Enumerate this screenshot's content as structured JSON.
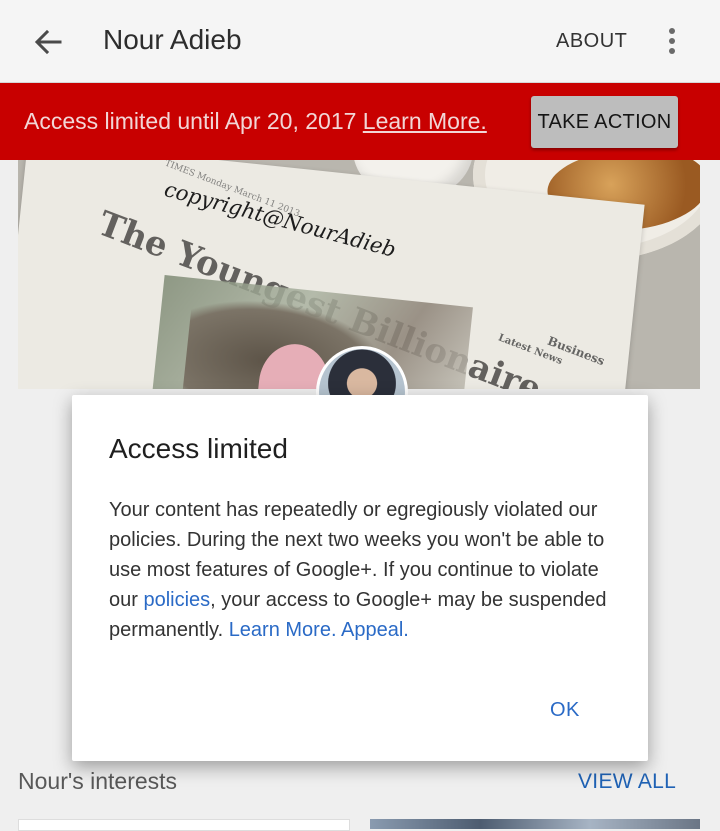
{
  "appbar": {
    "title": "Nour Adieb",
    "about_label": "ABOUT",
    "back_icon": "arrow-left-icon",
    "more_icon": "more-vert-icon"
  },
  "banner": {
    "text": "Access limited until Apr 20, 2017",
    "link": "Learn More.",
    "action_label": "TAKE ACTION",
    "color": "#c80000"
  },
  "cover": {
    "newspaper_date": "TIMES Monday March 11 2013",
    "newspaper_headline": "The Youngest Billionaire",
    "newspaper_section": "Business",
    "newspaper_subsection": "Latest News",
    "watermark": "copyright@NourAdieb"
  },
  "dialog": {
    "title": "Access limited",
    "body_part1": "Your content has repeatedly or egregiously violated our policies. During the next two weeks you won't be able to use most features of Google+. If you continue to violate our ",
    "policies_link": "policies",
    "body_part2": ", your access to Google+ may be suspended permanently. ",
    "learn_more_link": "Learn More.",
    "appeal_link": "Appeal.",
    "ok_label": "OK",
    "link_color": "#2a6ac6"
  },
  "interests": {
    "title": "Nour's interests",
    "view_all_label": "VIEW ALL"
  }
}
